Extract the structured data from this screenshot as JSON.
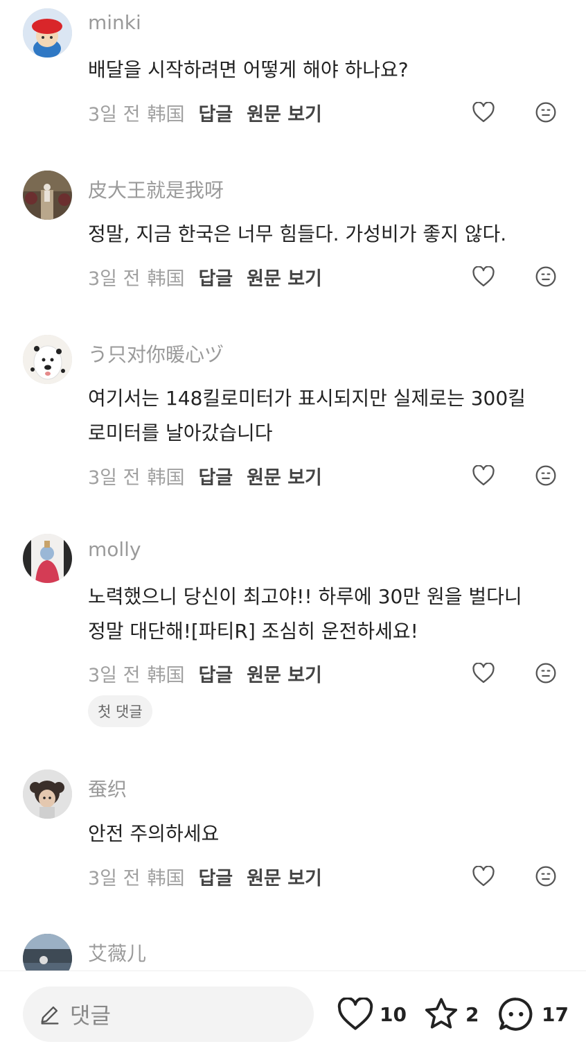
{
  "comments": [
    {
      "username": "minki",
      "text": "배달을 시작하려면 어떻게 해야 하나요?",
      "time": "3일 전",
      "location": "韩国",
      "reply": "답글",
      "original": "원문 보기"
    },
    {
      "username": "皮大王就是我呀",
      "text": "정말, 지금 한국은 너무 힘들다. 가성비가 좋지 않다.",
      "time": "3일 전",
      "location": "韩国",
      "reply": "답글",
      "original": "원문 보기"
    },
    {
      "username": "う只对你暖心ヅ",
      "text": "여기서는 148킬로미터가 표시되지만 실제로는 300킬\n로미터를 날아갔습니다",
      "time": "3일 전",
      "location": "韩国",
      "reply": "답글",
      "original": "원문 보기"
    },
    {
      "username": "molly",
      "text": "노력했으니 당신이 최고야!! 하루에 30만 원을 벌다니\n정말 대단해![파티R] 조심히 운전하세요!",
      "time": "3일 전",
      "location": "韩国",
      "reply": "답글",
      "original": "원문 보기",
      "badge": "첫 댓글"
    },
    {
      "username": "蚕织",
      "text": "안전 주의하세요",
      "time": "3일 전",
      "location": "韩国",
      "reply": "답글",
      "original": "원문 보기"
    },
    {
      "username": "艾薇儿"
    }
  ],
  "icons": {
    "like": "heart-outline-icon",
    "react": "emoji-neutral-icon",
    "pen": "pen-icon",
    "star": "star-outline-icon",
    "chat": "chat-bubble-icon"
  },
  "bottom_bar": {
    "comment_placeholder": "댓글",
    "like_count": "10",
    "favorite_count": "2",
    "comment_count": "17"
  }
}
